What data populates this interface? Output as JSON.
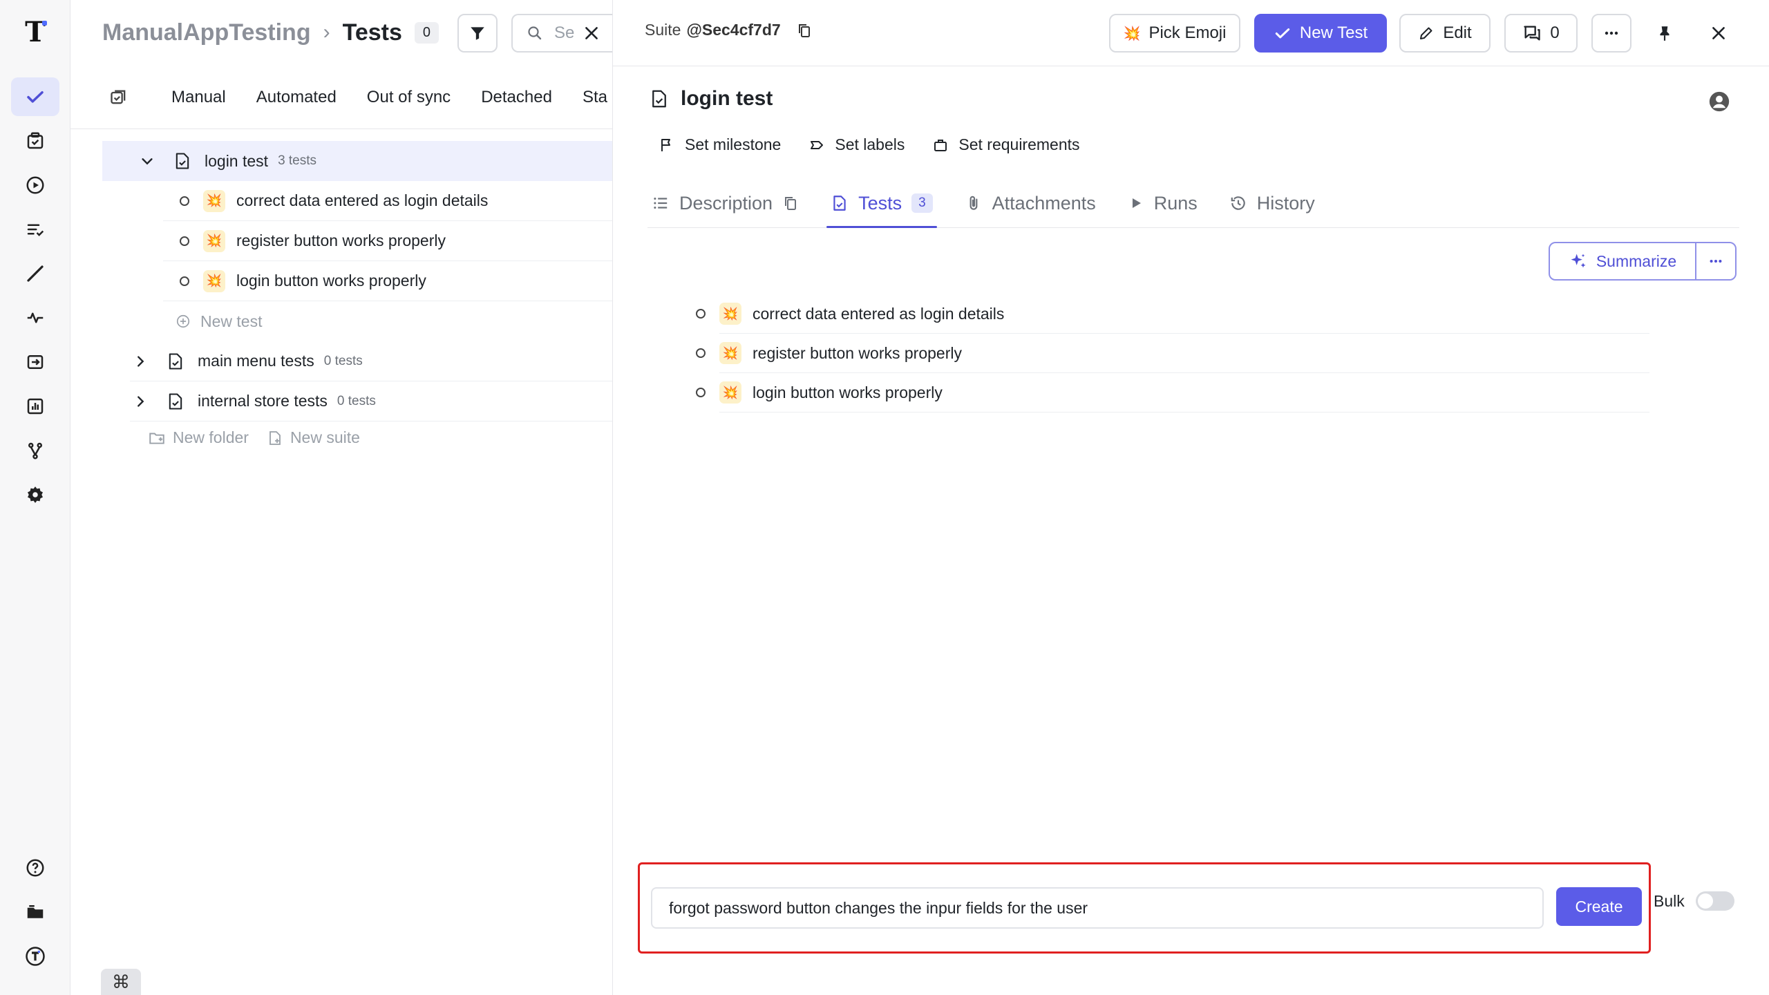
{
  "rail": {
    "items": [
      "tests-icon",
      "runs-icon",
      "play-icon",
      "plans-icon",
      "steps-icon",
      "pulse-icon",
      "import-icon",
      "analytics-icon",
      "branches-icon",
      "settings-icon"
    ],
    "bottom": [
      "help-icon",
      "projects-icon",
      "account-icon"
    ]
  },
  "header": {
    "project": "ManualAppTesting",
    "separator": "›",
    "page": "Tests",
    "count": "0",
    "search_placeholder": "Se"
  },
  "filter_tabs": [
    "Manual",
    "Automated",
    "Out of sync",
    "Detached",
    "Sta"
  ],
  "tree": {
    "selected_suite": {
      "name": "login test",
      "count": "3 tests"
    },
    "tests": [
      {
        "name": "correct data entered as login details"
      },
      {
        "name": "register button works properly"
      },
      {
        "name": "login button works properly"
      }
    ],
    "new_test": "New test",
    "suites": [
      {
        "name": "main menu tests",
        "count": "0 tests"
      },
      {
        "name": "internal store tests",
        "count": "0 tests"
      }
    ],
    "new_folder": "New folder",
    "new_suite": "New suite"
  },
  "shortcut": "⌘",
  "detail": {
    "suite_label": "Suite",
    "suite_id": "@Sec4cf7d7",
    "toolbar": {
      "pick_emoji": "Pick Emoji",
      "new_test": "New Test",
      "edit": "Edit",
      "comments": "0"
    },
    "title": "login test",
    "meta": {
      "milestone": "Set milestone",
      "labels": "Set labels",
      "requirements": "Set requirements"
    },
    "tabs": {
      "description": "Description",
      "tests": "Tests",
      "tests_count": "3",
      "attachments": "Attachments",
      "runs": "Runs",
      "history": "History"
    },
    "summarize": "Summarize",
    "tests": [
      {
        "name": "correct data entered as login details"
      },
      {
        "name": "register button works properly"
      },
      {
        "name": "login button works properly"
      }
    ],
    "create": {
      "value": "forgot password button changes the inpur fields for the user",
      "button": "Create",
      "bulk": "Bulk"
    }
  },
  "colors": {
    "accent": "#5b5ce8",
    "highlight_border": "#e02020",
    "selected_row": "#eef0fd"
  }
}
